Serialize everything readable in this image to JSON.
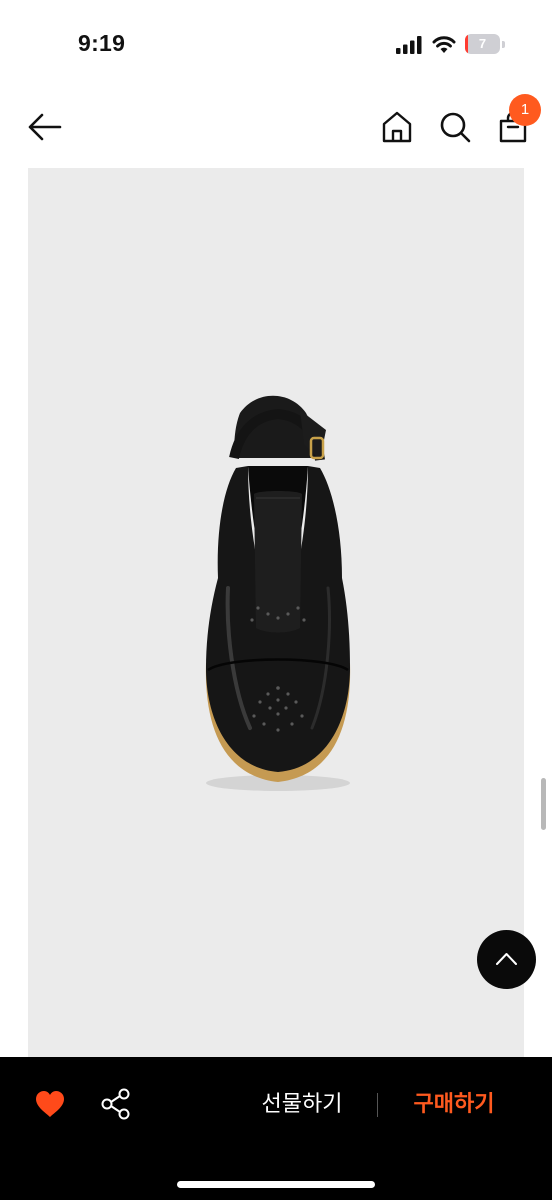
{
  "status_bar": {
    "time": "9:19",
    "battery_level_text": "7",
    "battery_level_fraction": 0.07,
    "icons": [
      "signal-icon",
      "wifi-icon",
      "battery-icon"
    ]
  },
  "top_nav": {
    "icons": [
      "back-arrow-icon",
      "home-icon",
      "search-icon",
      "shopping-bag-icon"
    ],
    "cart_badge_count": "1",
    "badge_color": "#ff5a1f"
  },
  "product": {
    "image_subject": "shoe-icon",
    "background_color": "#ebebeb"
  },
  "floating": {
    "scroll_top_icon": "chevron-up-icon"
  },
  "bottom_bar": {
    "icons": [
      "heart-icon",
      "share-icon"
    ],
    "gift_label": "선물하기",
    "buy_label": "구매하기",
    "accent_color": "#ff5a1f",
    "heart_color": "#ff4a1a"
  }
}
